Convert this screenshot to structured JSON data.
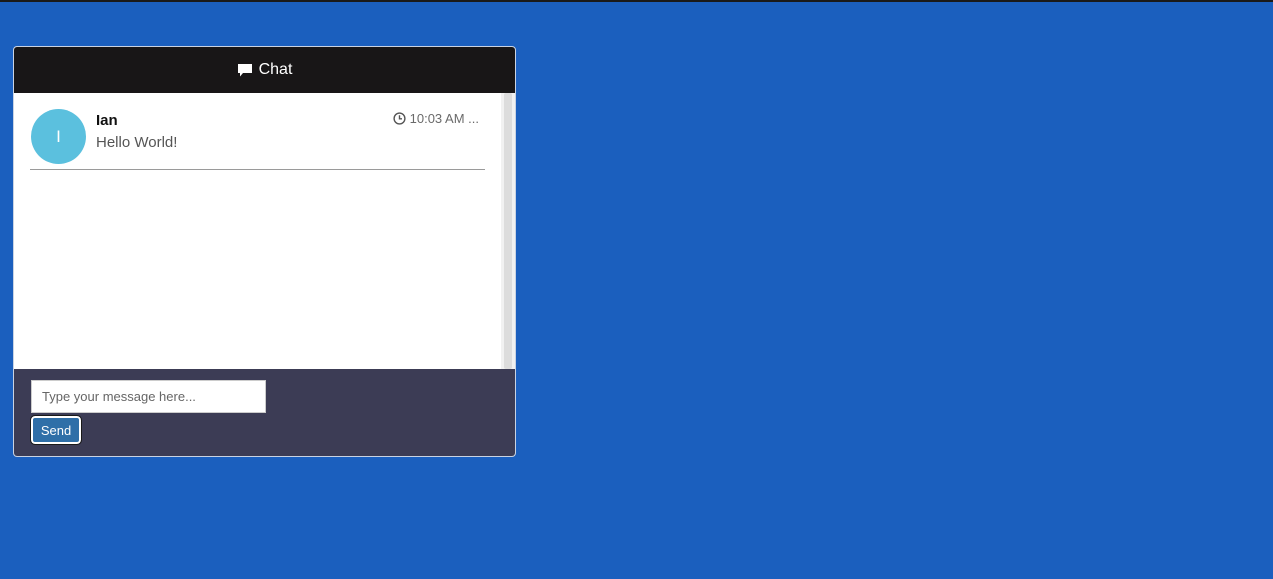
{
  "header": {
    "icon": "comment-icon",
    "title": "Chat"
  },
  "messages": [
    {
      "avatar_initial": "I",
      "avatar_color": "#5bc0de",
      "name": "Ian",
      "text": "Hello World!",
      "time_icon": "clock-icon",
      "time": "10:03 AM ..."
    }
  ],
  "composer": {
    "value": "",
    "placeholder": "Type your message here...",
    "send_label": "Send"
  },
  "colors": {
    "page_background": "#1b5fbe",
    "header_background": "#181617",
    "footer_background": "#3c3c55",
    "send_button": "#2f6fa8"
  }
}
